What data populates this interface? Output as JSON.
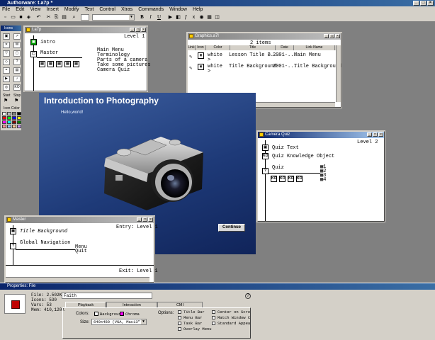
{
  "app": {
    "title": "Authorware: t.a7p *"
  },
  "menu": [
    "File",
    "Edit",
    "View",
    "Insert",
    "Modify",
    "Text",
    "Control",
    "Xtras",
    "Commands",
    "Window",
    "Help"
  ],
  "toolbar": {
    "bold": "B",
    "italic": "I",
    "underline": "U"
  },
  "icons_panel": {
    "title": "Icons",
    "start_label": "Start",
    "stop_label": "Stop",
    "icon_color_label": "Icon Color",
    "swatches": [
      "#ffffff",
      "#c0c0c0",
      "#808080",
      "#000000",
      "#ff0000",
      "#00ff00",
      "#0000ff",
      "#ffff00",
      "#ff00ff",
      "#00ffff",
      "#800000",
      "#008000",
      "#ff9999",
      "#99ccff",
      "#ffcc99",
      "#cc99ff"
    ]
  },
  "main_flow": {
    "title": "t.a7p",
    "level": "Level 1",
    "intro": "intro",
    "master": "Master",
    "items": [
      "Main Menu",
      "Terminology",
      "Parts of a camera",
      "Take some pictures",
      "Camera Quiz"
    ]
  },
  "graphics": {
    "title": "Graphics.a7l",
    "count": "2 items",
    "columns": [
      "Link",
      "Icon",
      "Color",
      "Title",
      "Date",
      "Link Name"
    ],
    "rows": [
      {
        "color": "white",
        "title": "Lesson Title B...",
        "date": "2001-...",
        "link_name": "Main Menu",
        "sub": ">"
      },
      {
        "color": "white",
        "title": "Title Background",
        "date": "2001-...",
        "link_name": "Title Background",
        "sub": ">"
      }
    ]
  },
  "presentation": {
    "title": "Introduction to Photography",
    "subtitle": "Hello,world!",
    "button": "Continue"
  },
  "camera_quiz": {
    "title": "Camera Quiz",
    "level": "Level 2",
    "items": [
      "Quiz Text",
      "Quiz Knowledge Object"
    ],
    "quiz": "Quiz",
    "answers": [
      "1",
      "2",
      "3",
      "4"
    ]
  },
  "master_win": {
    "title": "Master",
    "entry": "Entry: Level 1",
    "exit": "Exit: Level 1",
    "title_bg": "Title Background",
    "global_nav": "Global Navigation",
    "menu_items": [
      "Menu",
      "Quit"
    ]
  },
  "properties": {
    "title": "Properties: File",
    "file_size": "File: 2.502K",
    "icons": "Icons: 530",
    "vars": "Vars: 53",
    "mem": "Mem: 410,120K",
    "file_name": "Faith",
    "tabs": [
      "Playback",
      "Interaction",
      "CMI"
    ],
    "colors_label": "Colors:",
    "background_label": "Background",
    "chroma_label": "Chroma",
    "size_label": "Size:",
    "size_value": "640x480 (VGA, Mac13\")",
    "options_label": "Options:",
    "options_col1": [
      "Title Bar",
      "Menu Bar",
      "Task Bar",
      "Overlay Menu"
    ],
    "options_col2": [
      "Center on Screen",
      "Match Window Color",
      "Standard Appearance"
    ],
    "help": "?"
  }
}
